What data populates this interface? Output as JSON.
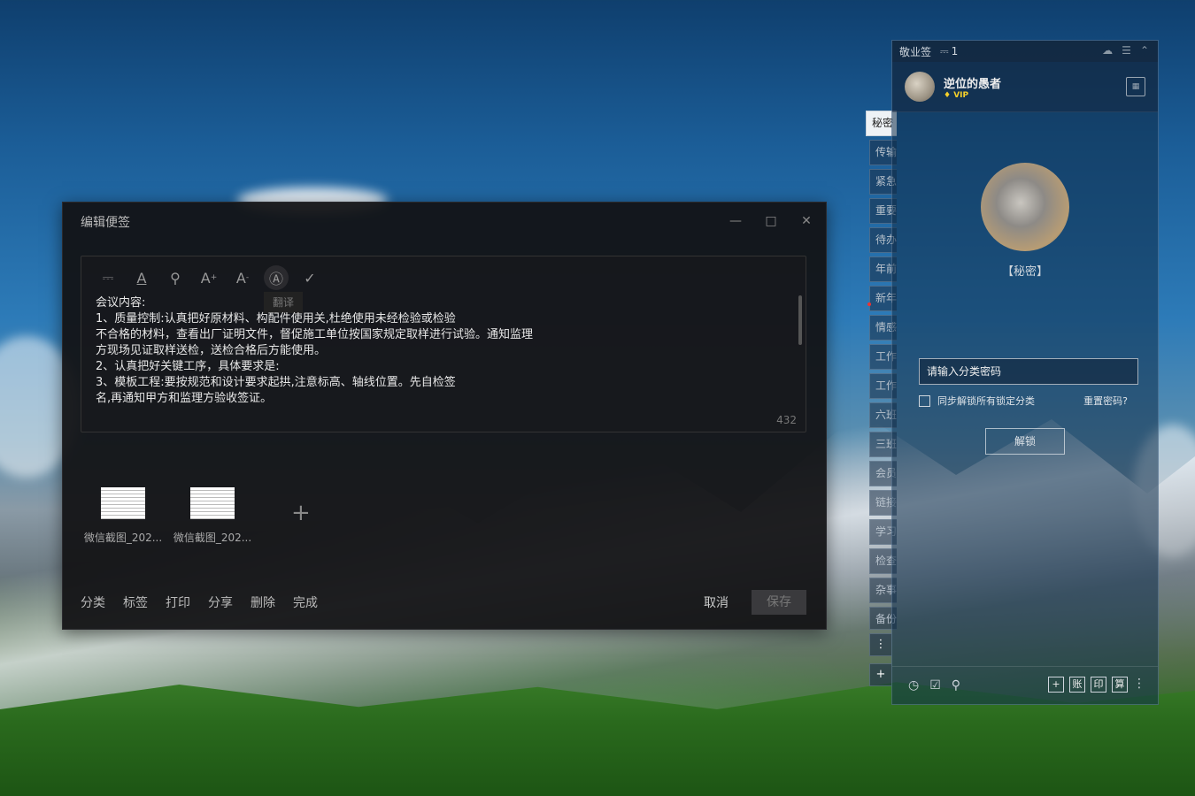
{
  "editor": {
    "title": "编辑便签",
    "toolbar_tooltip": "翻译",
    "content": "会议内容:\n1、质量控制:认真把好原材料、构配件使用关,杜绝使用未经检验或检验\n不合格的材料，查看出厂证明文件，督促施工单位按国家规定取样进行试验。通知监理\n方现场见证取样送检，送检合格后方能使用。\n2、认真把好关键工序，具体要求是:\n3、模板工程:要按规范和设计要求起拱,注意标高、轴线位置。先自检签\n名,再通知甲方和监理方验收签证。",
    "char_count": "432",
    "attachments": [
      {
        "name": "微信截图_202..."
      },
      {
        "name": "微信截图_202..."
      }
    ],
    "bottom_actions": [
      "分类",
      "标签",
      "打印",
      "分享",
      "删除",
      "完成"
    ],
    "cancel_label": "取消",
    "save_label": "保存"
  },
  "panel": {
    "app_name": "敬业签",
    "notification_count": "1",
    "username": "逆位的愚者",
    "vip_label": "VIP",
    "secret_label": "【秘密】",
    "password_placeholder": "请输入分类密码",
    "sync_label": "同步解锁所有锁定分类",
    "reset_label": "重置密码?",
    "unlock_label": "解锁",
    "bottom_right_icons": [
      "+",
      "账",
      "印",
      "算"
    ]
  },
  "side_tabs": [
    "秘密",
    "传输",
    "紧急",
    "重要",
    "待办",
    "年前",
    "新年",
    "情感",
    "工作",
    "工作",
    "六班",
    "三班",
    "会员",
    "链接",
    "学习",
    "检查",
    "杂事",
    "备份"
  ],
  "colors": {
    "editor_bg": "#121214",
    "panel_accent": "#0f2d4b",
    "vip_gold": "#f5d02a"
  }
}
